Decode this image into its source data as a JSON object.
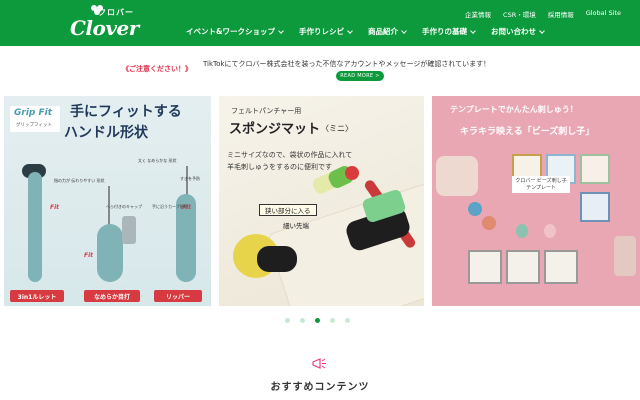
{
  "header": {
    "logo_katakana": "クロバー",
    "logo_word": "Clover",
    "util_links": [
      "企業情報",
      "CSR・環境",
      "採用情報",
      "Global Site"
    ],
    "main_nav": [
      "イベント&ワークショップ",
      "手作りレシピ",
      "商品紹介",
      "手作りの基礎",
      "お問い合わせ"
    ]
  },
  "notice": {
    "label": "《ご注意ください！》",
    "text": "TikTokにてクロバー株式会社を装った不信なアカウントやメッセージが確認されています！",
    "read_more": "READ MORE >"
  },
  "banners": {
    "b1": {
      "logo_title": "Grip Fit",
      "logo_sub": "グリップフィット",
      "head1": "手にフィットする",
      "head2": "ハンドル形状",
      "fit": "Fit",
      "notes": [
        "太く なめらかな 形状",
        "指の力が 伝わりやすい 形状",
        "へら付きのキャップ",
        "手に沿うカーブ形状",
        "すきを予防"
      ],
      "tags": [
        "3in1ルレット",
        "なめらか目打",
        "リッパー"
      ]
    },
    "b2": {
      "sub": "フェルトパンチャー用",
      "head": "スポンジマット",
      "head_small": "〈ミニ〉",
      "desc1": "ミニサイズなので、袋状の作品に入れて",
      "desc2": "羊毛刺しゅうをするのに便利です",
      "tag1": "狭い部分に入る",
      "tag2": "細い先端"
    },
    "b3": {
      "line1": "テンプレートでかんたん刺しゅう！",
      "line2": "キラキラ映える「ビーズ刺し子」",
      "label": "クロバー ビーズ刺し子テンプレート"
    }
  },
  "carousel": {
    "count": 5,
    "active_index": 2
  },
  "recommended": {
    "title": "おすすめコンテンツ"
  },
  "colors": {
    "brand_green": "#0c9a3c",
    "notice_red": "#e0304a",
    "dot_inactive": "#c9e7d3"
  }
}
